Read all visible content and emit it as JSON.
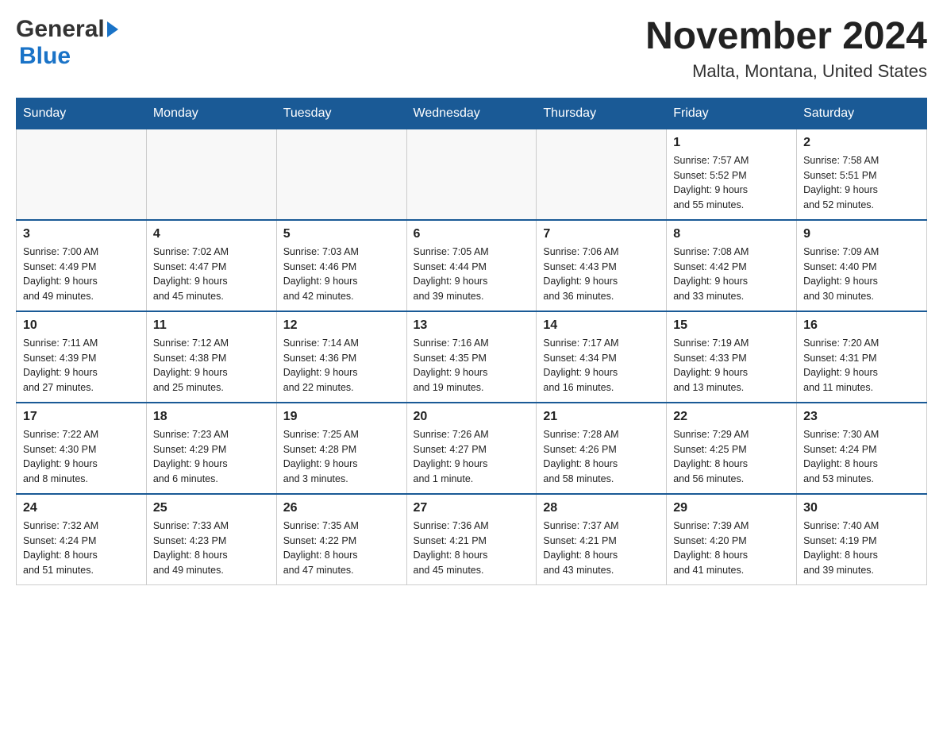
{
  "header": {
    "logo": {
      "general": "General",
      "blue": "Blue"
    },
    "title": "November 2024",
    "location": "Malta, Montana, United States"
  },
  "days_of_week": [
    "Sunday",
    "Monday",
    "Tuesday",
    "Wednesday",
    "Thursday",
    "Friday",
    "Saturday"
  ],
  "weeks": [
    [
      {
        "day": "",
        "info": ""
      },
      {
        "day": "",
        "info": ""
      },
      {
        "day": "",
        "info": ""
      },
      {
        "day": "",
        "info": ""
      },
      {
        "day": "",
        "info": ""
      },
      {
        "day": "1",
        "info": "Sunrise: 7:57 AM\nSunset: 5:52 PM\nDaylight: 9 hours\nand 55 minutes."
      },
      {
        "day": "2",
        "info": "Sunrise: 7:58 AM\nSunset: 5:51 PM\nDaylight: 9 hours\nand 52 minutes."
      }
    ],
    [
      {
        "day": "3",
        "info": "Sunrise: 7:00 AM\nSunset: 4:49 PM\nDaylight: 9 hours\nand 49 minutes."
      },
      {
        "day": "4",
        "info": "Sunrise: 7:02 AM\nSunset: 4:47 PM\nDaylight: 9 hours\nand 45 minutes."
      },
      {
        "day": "5",
        "info": "Sunrise: 7:03 AM\nSunset: 4:46 PM\nDaylight: 9 hours\nand 42 minutes."
      },
      {
        "day": "6",
        "info": "Sunrise: 7:05 AM\nSunset: 4:44 PM\nDaylight: 9 hours\nand 39 minutes."
      },
      {
        "day": "7",
        "info": "Sunrise: 7:06 AM\nSunset: 4:43 PM\nDaylight: 9 hours\nand 36 minutes."
      },
      {
        "day": "8",
        "info": "Sunrise: 7:08 AM\nSunset: 4:42 PM\nDaylight: 9 hours\nand 33 minutes."
      },
      {
        "day": "9",
        "info": "Sunrise: 7:09 AM\nSunset: 4:40 PM\nDaylight: 9 hours\nand 30 minutes."
      }
    ],
    [
      {
        "day": "10",
        "info": "Sunrise: 7:11 AM\nSunset: 4:39 PM\nDaylight: 9 hours\nand 27 minutes."
      },
      {
        "day": "11",
        "info": "Sunrise: 7:12 AM\nSunset: 4:38 PM\nDaylight: 9 hours\nand 25 minutes."
      },
      {
        "day": "12",
        "info": "Sunrise: 7:14 AM\nSunset: 4:36 PM\nDaylight: 9 hours\nand 22 minutes."
      },
      {
        "day": "13",
        "info": "Sunrise: 7:16 AM\nSunset: 4:35 PM\nDaylight: 9 hours\nand 19 minutes."
      },
      {
        "day": "14",
        "info": "Sunrise: 7:17 AM\nSunset: 4:34 PM\nDaylight: 9 hours\nand 16 minutes."
      },
      {
        "day": "15",
        "info": "Sunrise: 7:19 AM\nSunset: 4:33 PM\nDaylight: 9 hours\nand 13 minutes."
      },
      {
        "day": "16",
        "info": "Sunrise: 7:20 AM\nSunset: 4:31 PM\nDaylight: 9 hours\nand 11 minutes."
      }
    ],
    [
      {
        "day": "17",
        "info": "Sunrise: 7:22 AM\nSunset: 4:30 PM\nDaylight: 9 hours\nand 8 minutes."
      },
      {
        "day": "18",
        "info": "Sunrise: 7:23 AM\nSunset: 4:29 PM\nDaylight: 9 hours\nand 6 minutes."
      },
      {
        "day": "19",
        "info": "Sunrise: 7:25 AM\nSunset: 4:28 PM\nDaylight: 9 hours\nand 3 minutes."
      },
      {
        "day": "20",
        "info": "Sunrise: 7:26 AM\nSunset: 4:27 PM\nDaylight: 9 hours\nand 1 minute."
      },
      {
        "day": "21",
        "info": "Sunrise: 7:28 AM\nSunset: 4:26 PM\nDaylight: 8 hours\nand 58 minutes."
      },
      {
        "day": "22",
        "info": "Sunrise: 7:29 AM\nSunset: 4:25 PM\nDaylight: 8 hours\nand 56 minutes."
      },
      {
        "day": "23",
        "info": "Sunrise: 7:30 AM\nSunset: 4:24 PM\nDaylight: 8 hours\nand 53 minutes."
      }
    ],
    [
      {
        "day": "24",
        "info": "Sunrise: 7:32 AM\nSunset: 4:24 PM\nDaylight: 8 hours\nand 51 minutes."
      },
      {
        "day": "25",
        "info": "Sunrise: 7:33 AM\nSunset: 4:23 PM\nDaylight: 8 hours\nand 49 minutes."
      },
      {
        "day": "26",
        "info": "Sunrise: 7:35 AM\nSunset: 4:22 PM\nDaylight: 8 hours\nand 47 minutes."
      },
      {
        "day": "27",
        "info": "Sunrise: 7:36 AM\nSunset: 4:21 PM\nDaylight: 8 hours\nand 45 minutes."
      },
      {
        "day": "28",
        "info": "Sunrise: 7:37 AM\nSunset: 4:21 PM\nDaylight: 8 hours\nand 43 minutes."
      },
      {
        "day": "29",
        "info": "Sunrise: 7:39 AM\nSunset: 4:20 PM\nDaylight: 8 hours\nand 41 minutes."
      },
      {
        "day": "30",
        "info": "Sunrise: 7:40 AM\nSunset: 4:19 PM\nDaylight: 8 hours\nand 39 minutes."
      }
    ]
  ]
}
